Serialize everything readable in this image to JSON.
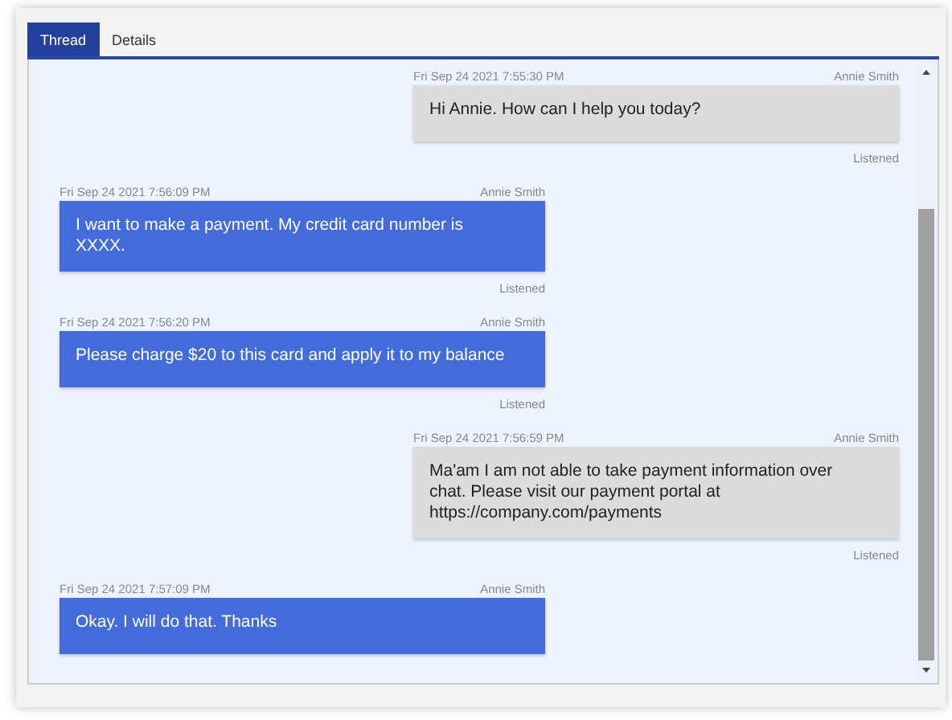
{
  "tabs": [
    {
      "label": "Thread",
      "selected": true
    },
    {
      "label": "Details",
      "selected": false
    }
  ],
  "messages": [
    {
      "kind": "outgoing",
      "time": "Fri Sep 24 2021 7:55:30 PM",
      "sender": "Annie Smith",
      "text": "Hi Annie. How can I help you today?",
      "status": "Listened"
    },
    {
      "kind": "incoming",
      "time": "Fri Sep 24 2021 7:56:09 PM",
      "sender": "Annie Smith",
      "text": "I want to make a payment. My credit card number is XXXX.",
      "status": "Listened"
    },
    {
      "kind": "incoming",
      "time": "Fri Sep 24 2021 7:56:20 PM",
      "sender": "Annie Smith",
      "text": "Please charge $20 to this card and apply it to my balance",
      "status": "Listened"
    },
    {
      "kind": "outgoing",
      "time": "Fri Sep 24 2021 7:56:59 PM",
      "sender": "Annie Smith",
      "text": "Ma'am I am not able to take payment information over chat. Please visit our payment portal at https://company.com/payments",
      "status": "Listened"
    },
    {
      "kind": "incoming",
      "time": "Fri Sep 24 2021 7:57:09 PM",
      "sender": "Annie Smith",
      "text": "Okay. I will do that. Thanks"
    }
  ]
}
